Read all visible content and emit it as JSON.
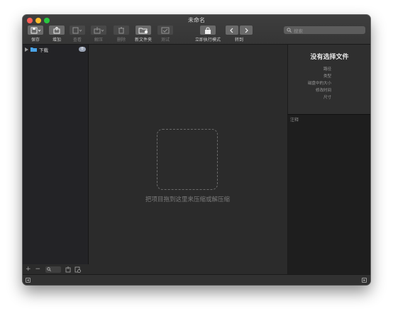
{
  "window": {
    "title": "未命名"
  },
  "toolbar": {
    "items": [
      {
        "label": "保存",
        "icon": "save-icon",
        "enabled": true
      },
      {
        "label": "增加",
        "icon": "add-icon",
        "enabled": true
      },
      {
        "label": "查看",
        "icon": "view-icon",
        "enabled": false
      },
      {
        "label": "解压",
        "icon": "extract-icon",
        "enabled": false
      },
      {
        "label": "删除",
        "icon": "trash-icon",
        "enabled": false
      },
      {
        "label": "新文件夹",
        "icon": "new-folder-icon",
        "enabled": true
      },
      {
        "label": "测试",
        "icon": "check-icon",
        "enabled": false
      },
      {
        "label": "立即执行模式",
        "icon": "lock-icon",
        "enabled": true
      },
      {
        "label": "转到",
        "icon": "nav-arrows-icon",
        "enabled": true
      }
    ],
    "search_placeholder": "搜索"
  },
  "sidebar": {
    "items": [
      {
        "label": "下载",
        "badge": "0"
      }
    ],
    "footer": {
      "add": "+",
      "remove": "−"
    }
  },
  "main": {
    "drop_hint": "把项目拖到这里来压缩或解压缩"
  },
  "info": {
    "title": "没有选择文件",
    "props": [
      "路径",
      "类型",
      "磁盘中的大小",
      "修改时间",
      "尺寸"
    ]
  },
  "notes": {
    "label": "注释"
  },
  "colors": {
    "close": "#fe5f57",
    "minimize": "#febc2e",
    "zoom": "#28c840",
    "badge": "#9aa3b4",
    "folder": "#4aa3e8"
  }
}
